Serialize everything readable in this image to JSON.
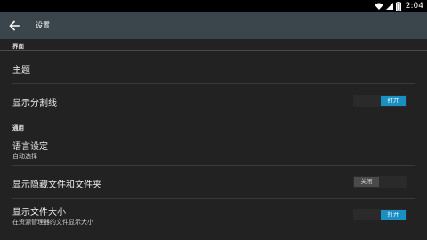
{
  "status_bar": {
    "time": "2:04",
    "icons": [
      "wifi-icon",
      "signal-icon",
      "battery-icon"
    ]
  },
  "app_bar": {
    "back_icon": "arrow-left-icon",
    "title": "设置"
  },
  "sections": {
    "interface": {
      "header": "界面",
      "theme_title": "主题",
      "divider_title": "显示分割线",
      "divider_toggle": "打开"
    },
    "general": {
      "header": "通用",
      "language_title": "语言设定",
      "language_sub": "自动选择",
      "hidden_title": "显示隐藏文件和文件夹",
      "hidden_toggle": "关闭",
      "size_title": "显示文件大小",
      "size_sub": "在资源管理器的文件显示大小",
      "size_toggle": "打开"
    }
  },
  "colors": {
    "accent": "#1a8fc3",
    "app_bar": "#3a464c",
    "background": "#222222"
  }
}
